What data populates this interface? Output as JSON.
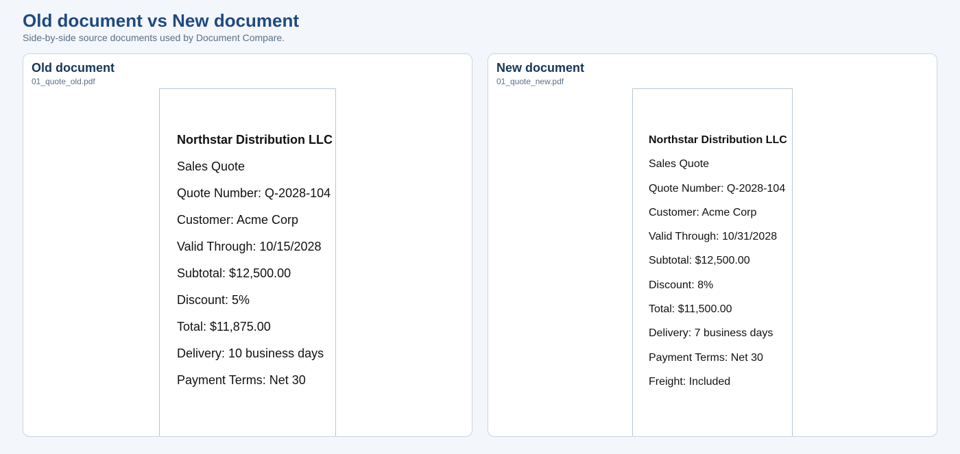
{
  "header": {
    "title": "Old document vs New document",
    "subtitle": "Side-by-side source documents used by Document Compare."
  },
  "old_doc": {
    "panel_title": "Old document",
    "filename": "01_quote_old.pdf",
    "lines": [
      "Northstar Distribution LLC",
      "Sales Quote",
      "Quote Number: Q-2028-104",
      "Customer: Acme Corp",
      "Valid Through: 10/15/2028",
      "Subtotal: $12,500.00",
      "Discount: 5%",
      "Total: $11,875.00",
      "Delivery: 10 business days",
      "Payment Terms: Net 30"
    ]
  },
  "new_doc": {
    "panel_title": "New document",
    "filename": "01_quote_new.pdf",
    "lines": [
      "Northstar Distribution LLC",
      "Sales Quote",
      "Quote Number: Q-2028-104",
      "Customer: Acme Corp",
      "Valid Through: 10/31/2028",
      "Subtotal: $12,500.00",
      "Discount: 8%",
      "Total: $11,500.00",
      "Delivery: 7 business days",
      "Payment Terms: Net 30",
      "Freight: Included"
    ]
  },
  "colors": {
    "title": "#1f4a80",
    "panel_border": "#c9d5e3",
    "background": "#f3f6fa"
  }
}
